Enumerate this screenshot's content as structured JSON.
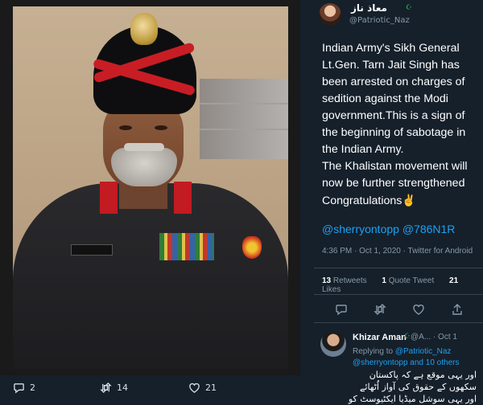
{
  "photo_tweet": {
    "reply_count": "2",
    "retweet_count": "14",
    "like_count": "21"
  },
  "tweet": {
    "display_name": "معاذ ناز",
    "flag_symbol": "☪",
    "handle": "@Patriotic_Naz",
    "body_paragraphs": [
      "Indian Army's Sikh General Lt.Gen. Tarn Jait Singh has been arrested on charges of sedition against the Modi government.This is a sign of the beginning of sabotage in the Indian Army.",
      "The Khalistan movement will now be further strengthened",
      "Congratulations"
    ],
    "emoji": "✌",
    "mentions": "@sherryontopp @786N1R",
    "meta": "4:36 PM · Oct 1, 2020 · Twitter for Android",
    "stats": {
      "retweets_count": "13",
      "retweets_label": "Retweets",
      "quote_count": "1",
      "quote_label": "Quote Tweet",
      "likes_count": "21",
      "likes_label": "Likes"
    }
  },
  "reply": {
    "name": "Khizar Aman",
    "flag_symbol": "☪",
    "handle": "@A... · Oct 1",
    "replying_prefix": "Replying to",
    "replying_to": "@Patriotic_Naz",
    "replying_more": "@sherryontopp and 10 others",
    "text": "اور یہی موقع ہے کہ پاکستان سکھوں کے حقوق کی آواز اُٹھائے اور یہی سوشل میڈیا ایکٹیوسٹ کو"
  },
  "colors": {
    "background": "#15202b",
    "link": "#1da1f2",
    "muted": "#8899a6",
    "divider": "#38444d"
  }
}
